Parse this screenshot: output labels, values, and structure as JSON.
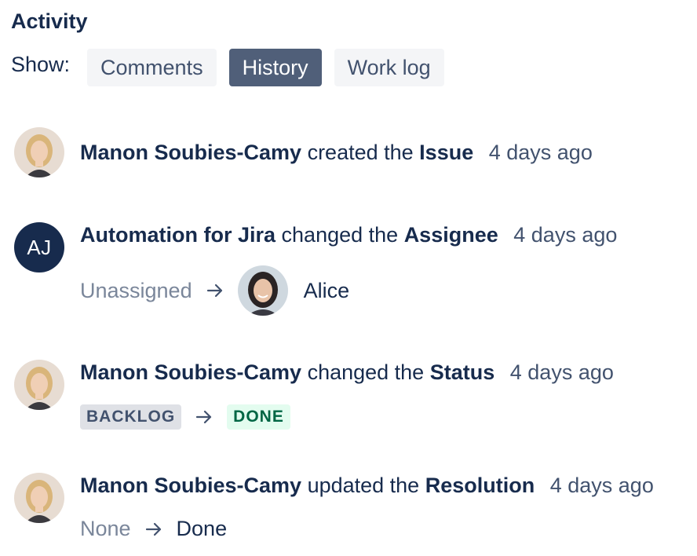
{
  "activity": {
    "title": "Activity",
    "show_label": "Show:",
    "tabs": [
      {
        "label": "Comments",
        "active": false
      },
      {
        "label": "History",
        "active": true
      },
      {
        "label": "Work log",
        "active": false
      }
    ]
  },
  "history": [
    {
      "actor": "Manon Soubies-Camy",
      "verb": "created the",
      "field": "Issue",
      "time": "4 days ago"
    },
    {
      "actor": "Automation for Jira",
      "actor_initials": "AJ",
      "verb": "changed the",
      "field": "Assignee",
      "time": "4 days ago",
      "from": "Unassigned",
      "to": "Alice"
    },
    {
      "actor": "Manon Soubies-Camy",
      "verb": "changed the",
      "field": "Status",
      "time": "4 days ago",
      "from": "BACKLOG",
      "to": "DONE"
    },
    {
      "actor": "Manon Soubies-Camy",
      "verb": "updated the",
      "field": "Resolution",
      "time": "4 days ago",
      "from": "None",
      "to": "Done"
    }
  ],
  "colors": {
    "text": "#172b4d",
    "subtle": "#42526e",
    "muted": "#7a869a",
    "active_tab": "#505f79",
    "tab_bg": "#f4f5f7",
    "done_bg": "#e3fcef",
    "done_text": "#006644"
  }
}
